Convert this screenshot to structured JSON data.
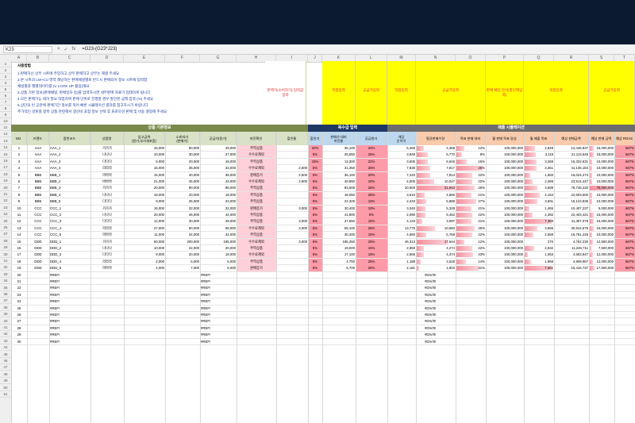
{
  "formula_bar": {
    "cell": "K23",
    "icons": [
      "×",
      "✓",
      "fx"
    ],
    "formula": "=G23-(G23*J23)"
  },
  "col_letters": [
    "A",
    "B",
    "C",
    "D",
    "E",
    "F",
    "G",
    "H",
    "I",
    "J",
    "K",
    "L",
    "M",
    "N",
    "O",
    "P",
    "Q",
    "R",
    "S",
    "T"
  ],
  "guide": {
    "title": "사용방법",
    "lines": [
      "1.판매하신 상부 시트에 주입하고 상부 판매하고 상부는 해결 주세요",
      "2.본 시트의 LM~CU 영역 해당하는 판매채널별로 반드시 판매되어 정보 시트에 입력합",
      "  채널별과 월별데이터를 (V LOOK UP 활용)해요",
      "3.상품 기본 정보(판매채널, 판매일자 등)를 입력하시면 세부판매 자료가 업데이트 됩니다",
      "4.모든 판매가능 대하 필요 작업하여 판매 단위로 진행할 경우 할인된 금액 입력 (%) 주세요",
      "5.상단의 빈 공란에 판매기간 정보를 적어 빠른 시뮬레이션 결과를 참고하시기 바랍니다",
      "추가적인 검토할 항목 상품 관련해서 생산비 포함 정보 선택 후 프로모션 판매 및 비용 결정해 주세요"
    ]
  },
  "yellow_notes": [
    "판매가(소비자가)\n입력값 입력",
    "직접입력",
    "공급가입력",
    "직접입력",
    "공급가입력",
    "판매 채널 분석(할인액입력)",
    "직접입력",
    "공급가입력"
  ],
  "banners": {
    "product": "상품 기본정보",
    "discount": "복수급 입력",
    "sim": "매출 시뮬레이션"
  },
  "headers": [
    "NO.",
    "브랜드",
    "품번코드",
    "상품명",
    "입고금액\n(원가,부가세포함)",
    "소비자가\n(판매가)",
    "공급가(원가)",
    "마진확인",
    "할인율",
    "할인가",
    "판매가 대비\n마진율",
    "공급원가",
    "개당\n순이익",
    "평균판매수량",
    "목표 판매 대비",
    "월 판매 목표 달성",
    "월 매출 목표",
    "예상 판매금액",
    "예상 판매 금액",
    "예상 ROAS"
  ],
  "rows": [
    [
      "1",
      "AAA",
      "AAA_1",
      "가가가",
      "15,000",
      "50,000",
      "49,000",
      "주력상품",
      "",
      "22%",
      "35,100",
      "24%",
      "5,265",
      "4,368",
      "12%",
      "100,000,000",
      "2,849",
      "12,446,937",
      "15,000,000",
      "667%"
    ],
    [
      "2",
      "AAA",
      "AAA_2",
      "나나나",
      "10,000",
      "30,000",
      "27,000",
      "수수료제외",
      "",
      "5%",
      "25,650",
      "25%",
      "3,848",
      "6,770",
      "8%",
      "100,000,000",
      "3,119",
      "21,113,645",
      "15,000,000",
      "667%"
    ],
    [
      "3",
      "AAA",
      "AAA_3",
      "다다다",
      "5,000",
      "20,000",
      "18,000",
      "주력상품",
      "",
      "15%",
      "13,300",
      "22%",
      "3,605",
      "6,646",
      "15%",
      "100,000,000",
      "3,268",
      "16,322,631",
      "10,000,000",
      "667%"
    ],
    [
      "4",
      "AAA",
      "AAA_4",
      "라라라",
      "15,000",
      "35,000",
      "33,000",
      "수수료제외",
      "2,500",
      "5%",
      "31,350",
      "25%",
      "7,838",
      "7,817",
      "36%",
      "100,000,000",
      "3,361",
      "41,135,184",
      "10,000,000",
      "667%"
    ],
    [
      "5",
      "BBB",
      "BBB_1",
      "마마마",
      "15,000",
      "40,000",
      "38,000",
      "판매증가",
      "2,500",
      "5%",
      "36,100",
      "20%",
      "7,220",
      "7,813",
      "22%",
      "100,000,000",
      "1,683",
      "16,024,273",
      "10,000,000",
      "667%"
    ],
    [
      "6",
      "BBB",
      "BBB_2",
      "바바바",
      "21,000",
      "45,000",
      "43,000",
      "수수료제외",
      "2,500",
      "5%",
      "40,850",
      "10%",
      "4,505",
      "10,027",
      "22%",
      "100,000,000",
      "2,369",
      "23,514,447",
      "10,000,000",
      "667%"
    ],
    [
      "7",
      "BBB",
      "BBB_3",
      "가가가",
      "20,000",
      "90,000",
      "88,000",
      "주력상품",
      "",
      "5%",
      "83,600",
      "25%",
      "20,900",
      "21,943",
      "25%",
      "100,000,000",
      "3,589",
      "76,745,220",
      "75,000,000",
      "667%"
    ],
    [
      "8",
      "BBB",
      "BBB_4",
      "나나나",
      "18,000",
      "20,000",
      "18,000",
      "주력상품",
      "",
      "5%",
      "18,050",
      "25%",
      "3,610",
      "4,866",
      "21%",
      "100,000,000",
      "4,153",
      "22,603,500",
      "10,000,000",
      "667%"
    ],
    [
      "9",
      "BBB",
      "BBB_5",
      "다다다",
      "9,000",
      "25,000",
      "23,000",
      "주력상품",
      "",
      "5%",
      "22,325",
      "10%",
      "2,233",
      "5,888",
      "27%",
      "100,000,000",
      "3,591",
      "15,123,935",
      "10,000,000",
      "667%"
    ],
    [
      "10",
      "CCC",
      "CCC_1",
      "가가가",
      "15,000",
      "32,000",
      "32,000",
      "판매증가",
      "3,000",
      "5%",
      "30,400",
      "10%",
      "3,040",
      "5,328",
      "21%",
      "100,000,000",
      "1,465",
      "10,407,237",
      "5,000,000",
      "667%"
    ],
    [
      "11",
      "CCC",
      "CCC_2",
      "나나나",
      "20,000",
      "46,000",
      "44,000",
      "주력상품",
      "",
      "5%",
      "41,800",
      "5%",
      "2,090",
      "5,452",
      "22%",
      "100,000,000",
      "2,392",
      "22,403,421",
      "15,000,000",
      "667%"
    ],
    [
      "12",
      "CCC",
      "CCC_3",
      "다다다",
      "12,000",
      "30,000",
      "29,000",
      "주력상품",
      "3,000",
      "5%",
      "27,550",
      "15%",
      "4,133",
      "3,697",
      "21%",
      "100,000,000",
      "7,369",
      "41,357,078",
      "15,000,000",
      "667%"
    ],
    [
      "13",
      "CCC",
      "CCC_4",
      "라라라",
      "27,000",
      "60,000",
      "58,000",
      "수수료제외",
      "3,000",
      "5%",
      "55,100",
      "25%",
      "13,775",
      "10,683",
      "25%",
      "100,000,000",
      "3,656",
      "30,914,575",
      "15,000,000",
      "667%"
    ],
    [
      "14",
      "CCC",
      "CCC_5",
      "마마마",
      "11,000",
      "34,000",
      "32,000",
      "주력상품",
      "",
      "5%",
      "30,400",
      "15%",
      "4,560",
      "5,768",
      "22%",
      "100,000,000",
      "2,559",
      "16,761,226",
      "10,000,000",
      "667%"
    ],
    [
      "15",
      "DDD",
      "DDD_1",
      "가가가",
      "50,000",
      "200,000",
      "195,000",
      "수수료제외",
      "3,000",
      "5%",
      "185,250",
      "25%",
      "46,313",
      "17,644",
      "12%",
      "100,000,000",
      "270",
      "4,752,230",
      "12,500,000",
      "667%"
    ],
    [
      "16",
      "DDD",
      "DDD_2",
      "나나나",
      "10,000",
      "22,000",
      "20,000",
      "주력상품",
      "",
      "5%",
      "19,000",
      "15%",
      "2,850",
      "4,274",
      "22%",
      "100,000,000",
      "2,632",
      "11,246,711",
      "7,500,000",
      "667%"
    ],
    [
      "17",
      "DDD",
      "DDD_3",
      "다다다",
      "9,000",
      "20,000",
      "18,000",
      "수수료제외",
      "",
      "5%",
      "17,100",
      "15%",
      "2,565",
      "4,374",
      "23%",
      "100,000,000",
      "1,053",
      "4,603,947",
      "12,000,000",
      "667%"
    ],
    [
      "18",
      "DDD",
      "DDD_4",
      "라라라",
      "2,000",
      "6,000",
      "5,000",
      "주력상품",
      "",
      "5%",
      "4,750",
      "25%",
      "1,188",
      "2,528",
      "14%",
      "100,000,000",
      "1,968",
      "4,909,967",
      "12,000,000",
      "667%"
    ],
    [
      "19",
      "DDD",
      "DDD_5",
      "마마마",
      "4,000",
      "7,000",
      "6,000",
      "판매증가",
      "",
      "5%",
      "5,700",
      "25%",
      "2,181",
      "1,903",
      "31%",
      "100,000,000",
      "7,661",
      "15,416,737",
      "17,500,000",
      "667%"
    ]
  ],
  "empty_rows": {
    "no_values": [
      "20",
      "21",
      "22",
      "23",
      "24",
      "25",
      "26",
      "27",
      "28",
      "29",
      "30"
    ],
    "ref_text": "#REF!",
    "div_text": "#DIV/0!"
  },
  "colors": {
    "yellow": "#ffff00",
    "navy": "#1f3864",
    "olive": "#7a8a4a",
    "grey": "#6d6d6d",
    "pink": "#ffd0d8",
    "bar": "#f58d9b"
  }
}
